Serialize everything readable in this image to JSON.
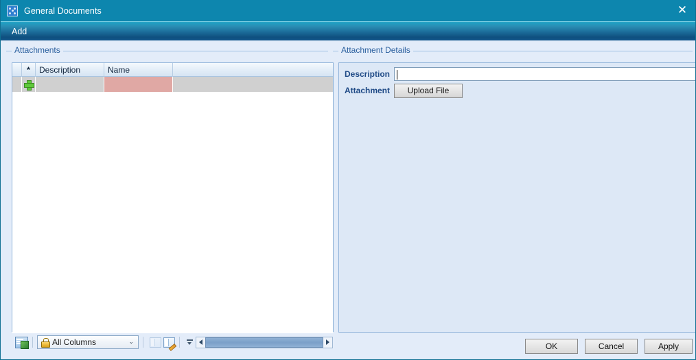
{
  "window": {
    "title": "General Documents",
    "icon": "app-window-icon",
    "close_label": "✕"
  },
  "menubar": {
    "items": [
      {
        "label": "Add",
        "name": "menu-item-add"
      }
    ]
  },
  "attachments": {
    "legend": "Attachments",
    "grid": {
      "columns": [
        {
          "key": "indicator",
          "label": ""
        },
        {
          "key": "star",
          "label": "*"
        },
        {
          "key": "description",
          "label": "Description"
        },
        {
          "key": "name",
          "label": "Name"
        },
        {
          "key": "filler",
          "label": ""
        }
      ],
      "rows": [
        {
          "type": "new-row",
          "indicator_icon": "add-row-plus-icon",
          "description": "",
          "name": "",
          "name_required": true
        }
      ]
    },
    "toolbar": {
      "export_icon": "export-to-excel-icon",
      "columns_filter": {
        "icon": "lock-icon",
        "value": "All Columns",
        "chevron": "⌄"
      },
      "layout_icon": "grid-layout-icon",
      "layout_edit_icon": "grid-layout-edit-icon",
      "splitter_icon": "collapse-handle-icon",
      "scrollbar": {
        "left_arrow": "scroll-left-arrow-icon",
        "right_arrow": "scroll-right-arrow-icon"
      }
    }
  },
  "details": {
    "legend": "Attachment Details",
    "fields": [
      {
        "label": "Description",
        "type": "text",
        "value": "",
        "placeholder": ""
      },
      {
        "label": "Attachment",
        "type": "button",
        "button_label": "Upload File"
      }
    ]
  },
  "footer": {
    "buttons": [
      {
        "label": "OK",
        "name": "ok-button"
      },
      {
        "label": "Cancel",
        "name": "cancel-button"
      },
      {
        "label": "Apply",
        "name": "apply-button"
      }
    ]
  },
  "colors": {
    "titlebar": "#0d86ae",
    "menubar_top": "#2fa6c6",
    "menubar_bottom": "#0f4f7f",
    "surface": "#e3ecf9",
    "legend_text": "#2a5f9e",
    "field_label": "#1f4a86",
    "required_cell": "#e0a8a4",
    "new_row": "#d0d0d0"
  }
}
